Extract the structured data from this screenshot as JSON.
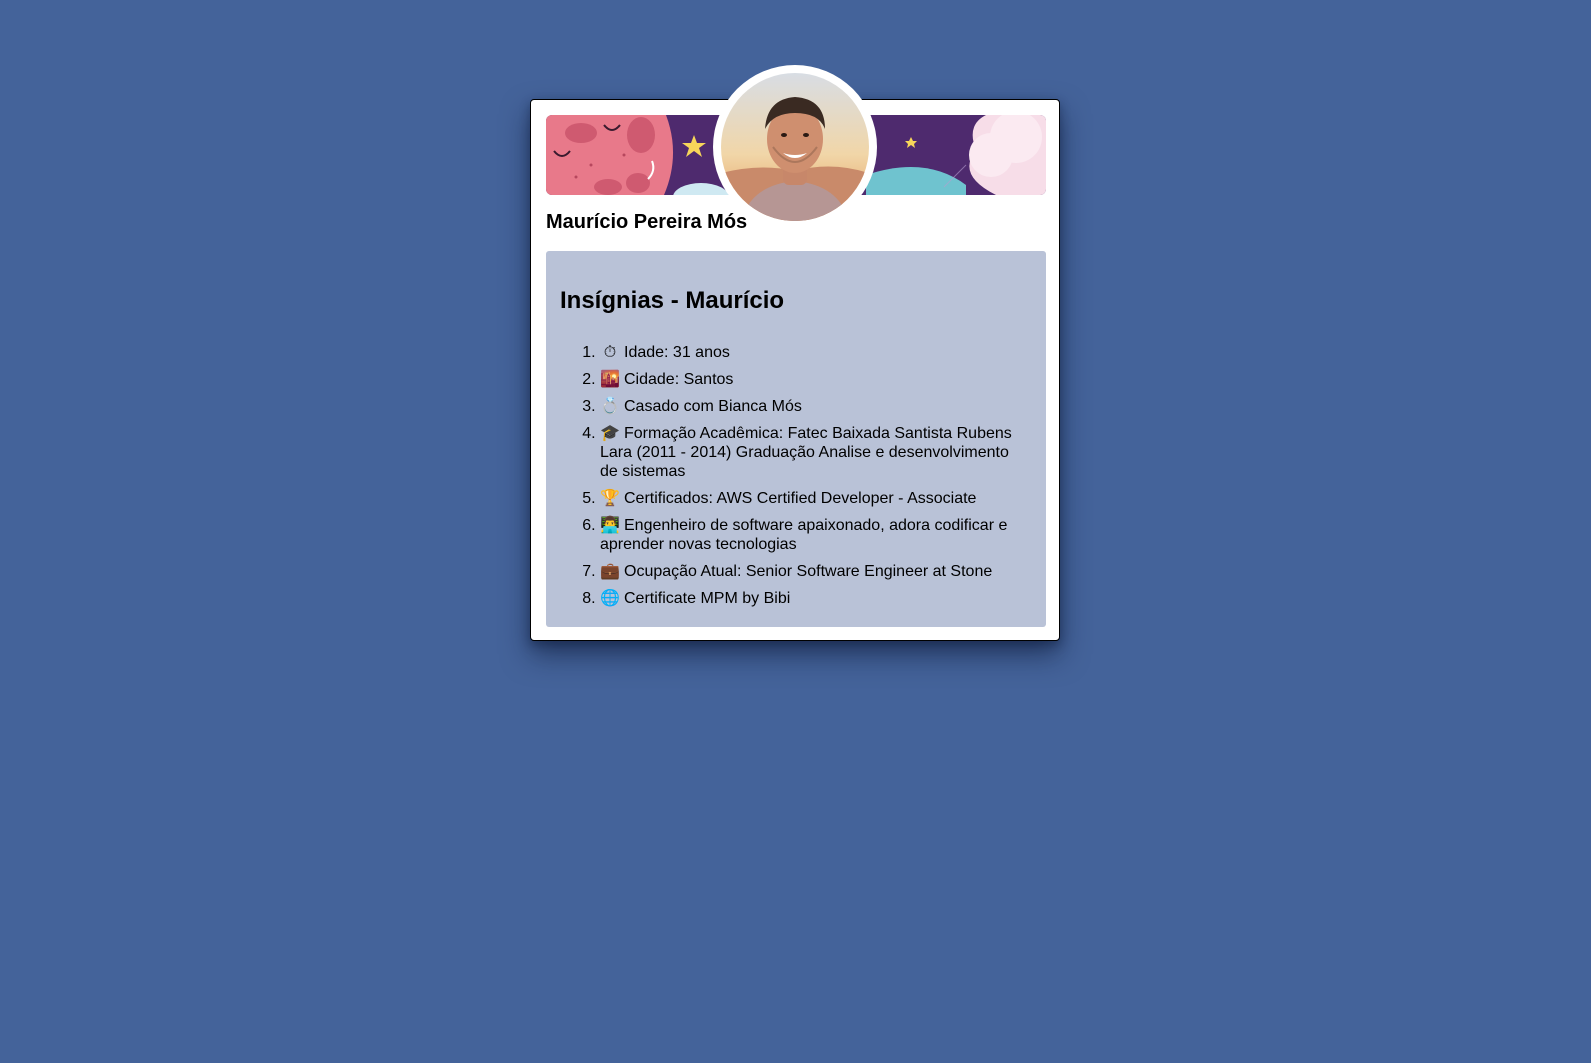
{
  "colors": {
    "page_background": "#44639a",
    "card_background": "#ffffff",
    "badges_background": "#b9c2d7"
  },
  "profile": {
    "name": "Maurício Pereira Mós",
    "avatar_icon": "profile-photo"
  },
  "badges": {
    "title": "Insígnias - Maurício",
    "items": [
      {
        "icon": "stopwatch-icon",
        "glyph": "⏱",
        "text": "Idade: 31 anos"
      },
      {
        "icon": "city-sunset-icon",
        "glyph": "🌇",
        "text": "Cidade: Santos"
      },
      {
        "icon": "ring-icon",
        "glyph": "💍",
        "text": "Casado com Bianca Mós"
      },
      {
        "icon": "graduation-cap-icon",
        "glyph": "🎓",
        "text": "Formação Acadêmica: Fatec Baixada Santista Rubens Lara (2011 - 2014) Graduação Analise e desenvolvimento de sistemas"
      },
      {
        "icon": "trophy-icon",
        "glyph": "🏆",
        "text": "Certificados: AWS Certified Developer - Associate"
      },
      {
        "icon": "technologist-icon",
        "glyph": "👨‍💻",
        "text": "Engenheiro de software apaixonado, adora codificar e aprender novas tecnologias"
      },
      {
        "icon": "briefcase-icon",
        "glyph": "💼",
        "text": "Ocupação Atual: Senior Software Engineer at Stone"
      },
      {
        "icon": "globe-icon",
        "glyph": "🌐",
        "text": "Certificate MPM by Bibi"
      }
    ]
  }
}
